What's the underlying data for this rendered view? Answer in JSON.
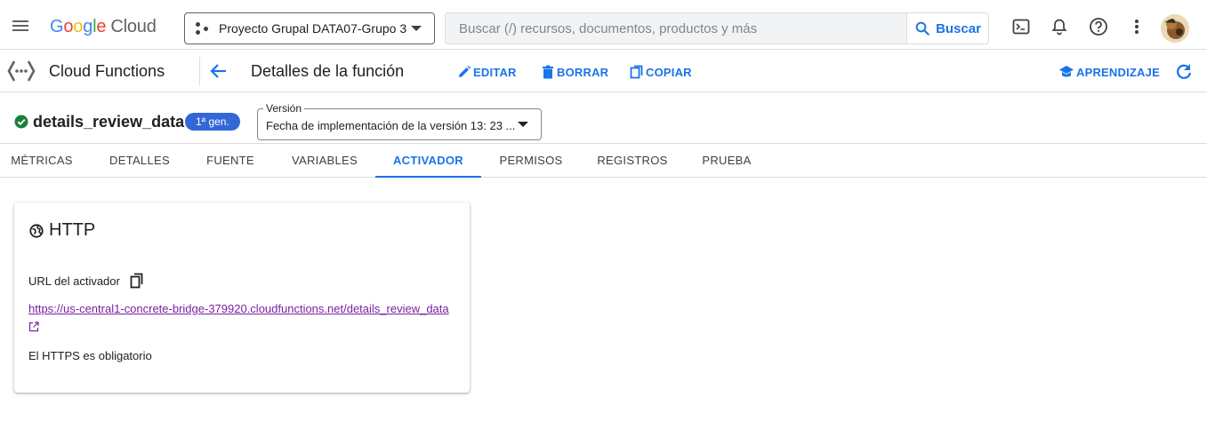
{
  "header": {
    "logo": {
      "g": "G",
      "o1": "o",
      "o2": "o",
      "g2": "g",
      "l": "l",
      "e": "e",
      "cloud": "Cloud"
    },
    "project": "Proyecto Grupal DATA07-Grupo 3",
    "search": {
      "placeholder": "Buscar (/) recursos, documentos, productos y más",
      "button": "Buscar"
    },
    "icons": [
      "menu-icon",
      "terminal-icon",
      "bell-icon",
      "help-icon",
      "more-vert-icon"
    ]
  },
  "service": {
    "name": "Cloud Functions",
    "page_title": "Detalles de la función",
    "actions": {
      "edit": "EDITAR",
      "delete": "BORRAR",
      "copy": "COPIAR",
      "learn": "APRENDIZAJE"
    }
  },
  "function": {
    "name": "details_review_data",
    "gen": "1ª gen.",
    "version_label": "Versión",
    "version_value": "Fecha de implementación de la versión 13: 23 ..."
  },
  "tabs": [
    {
      "label": "MÉTRICAS"
    },
    {
      "label": "DETALLES"
    },
    {
      "label": "FUENTE"
    },
    {
      "label": "VARIABLES"
    },
    {
      "label": "ACTIVADOR"
    },
    {
      "label": "PERMISOS"
    },
    {
      "label": "REGISTROS"
    },
    {
      "label": "PRUEBA"
    }
  ],
  "active_tab": "ACTIVADOR",
  "trigger": {
    "title": "HTTP",
    "url_label": "URL del activador",
    "url": "https://us-central1-concrete-bridge-379920.cloudfunctions.net/details_review_data",
    "https_note": "El HTTPS es obligatorio"
  },
  "colors": {
    "accent": "#1a73e8",
    "success": "#188038",
    "badge": "#3367d6",
    "link_visited": "#7b1fa2"
  }
}
